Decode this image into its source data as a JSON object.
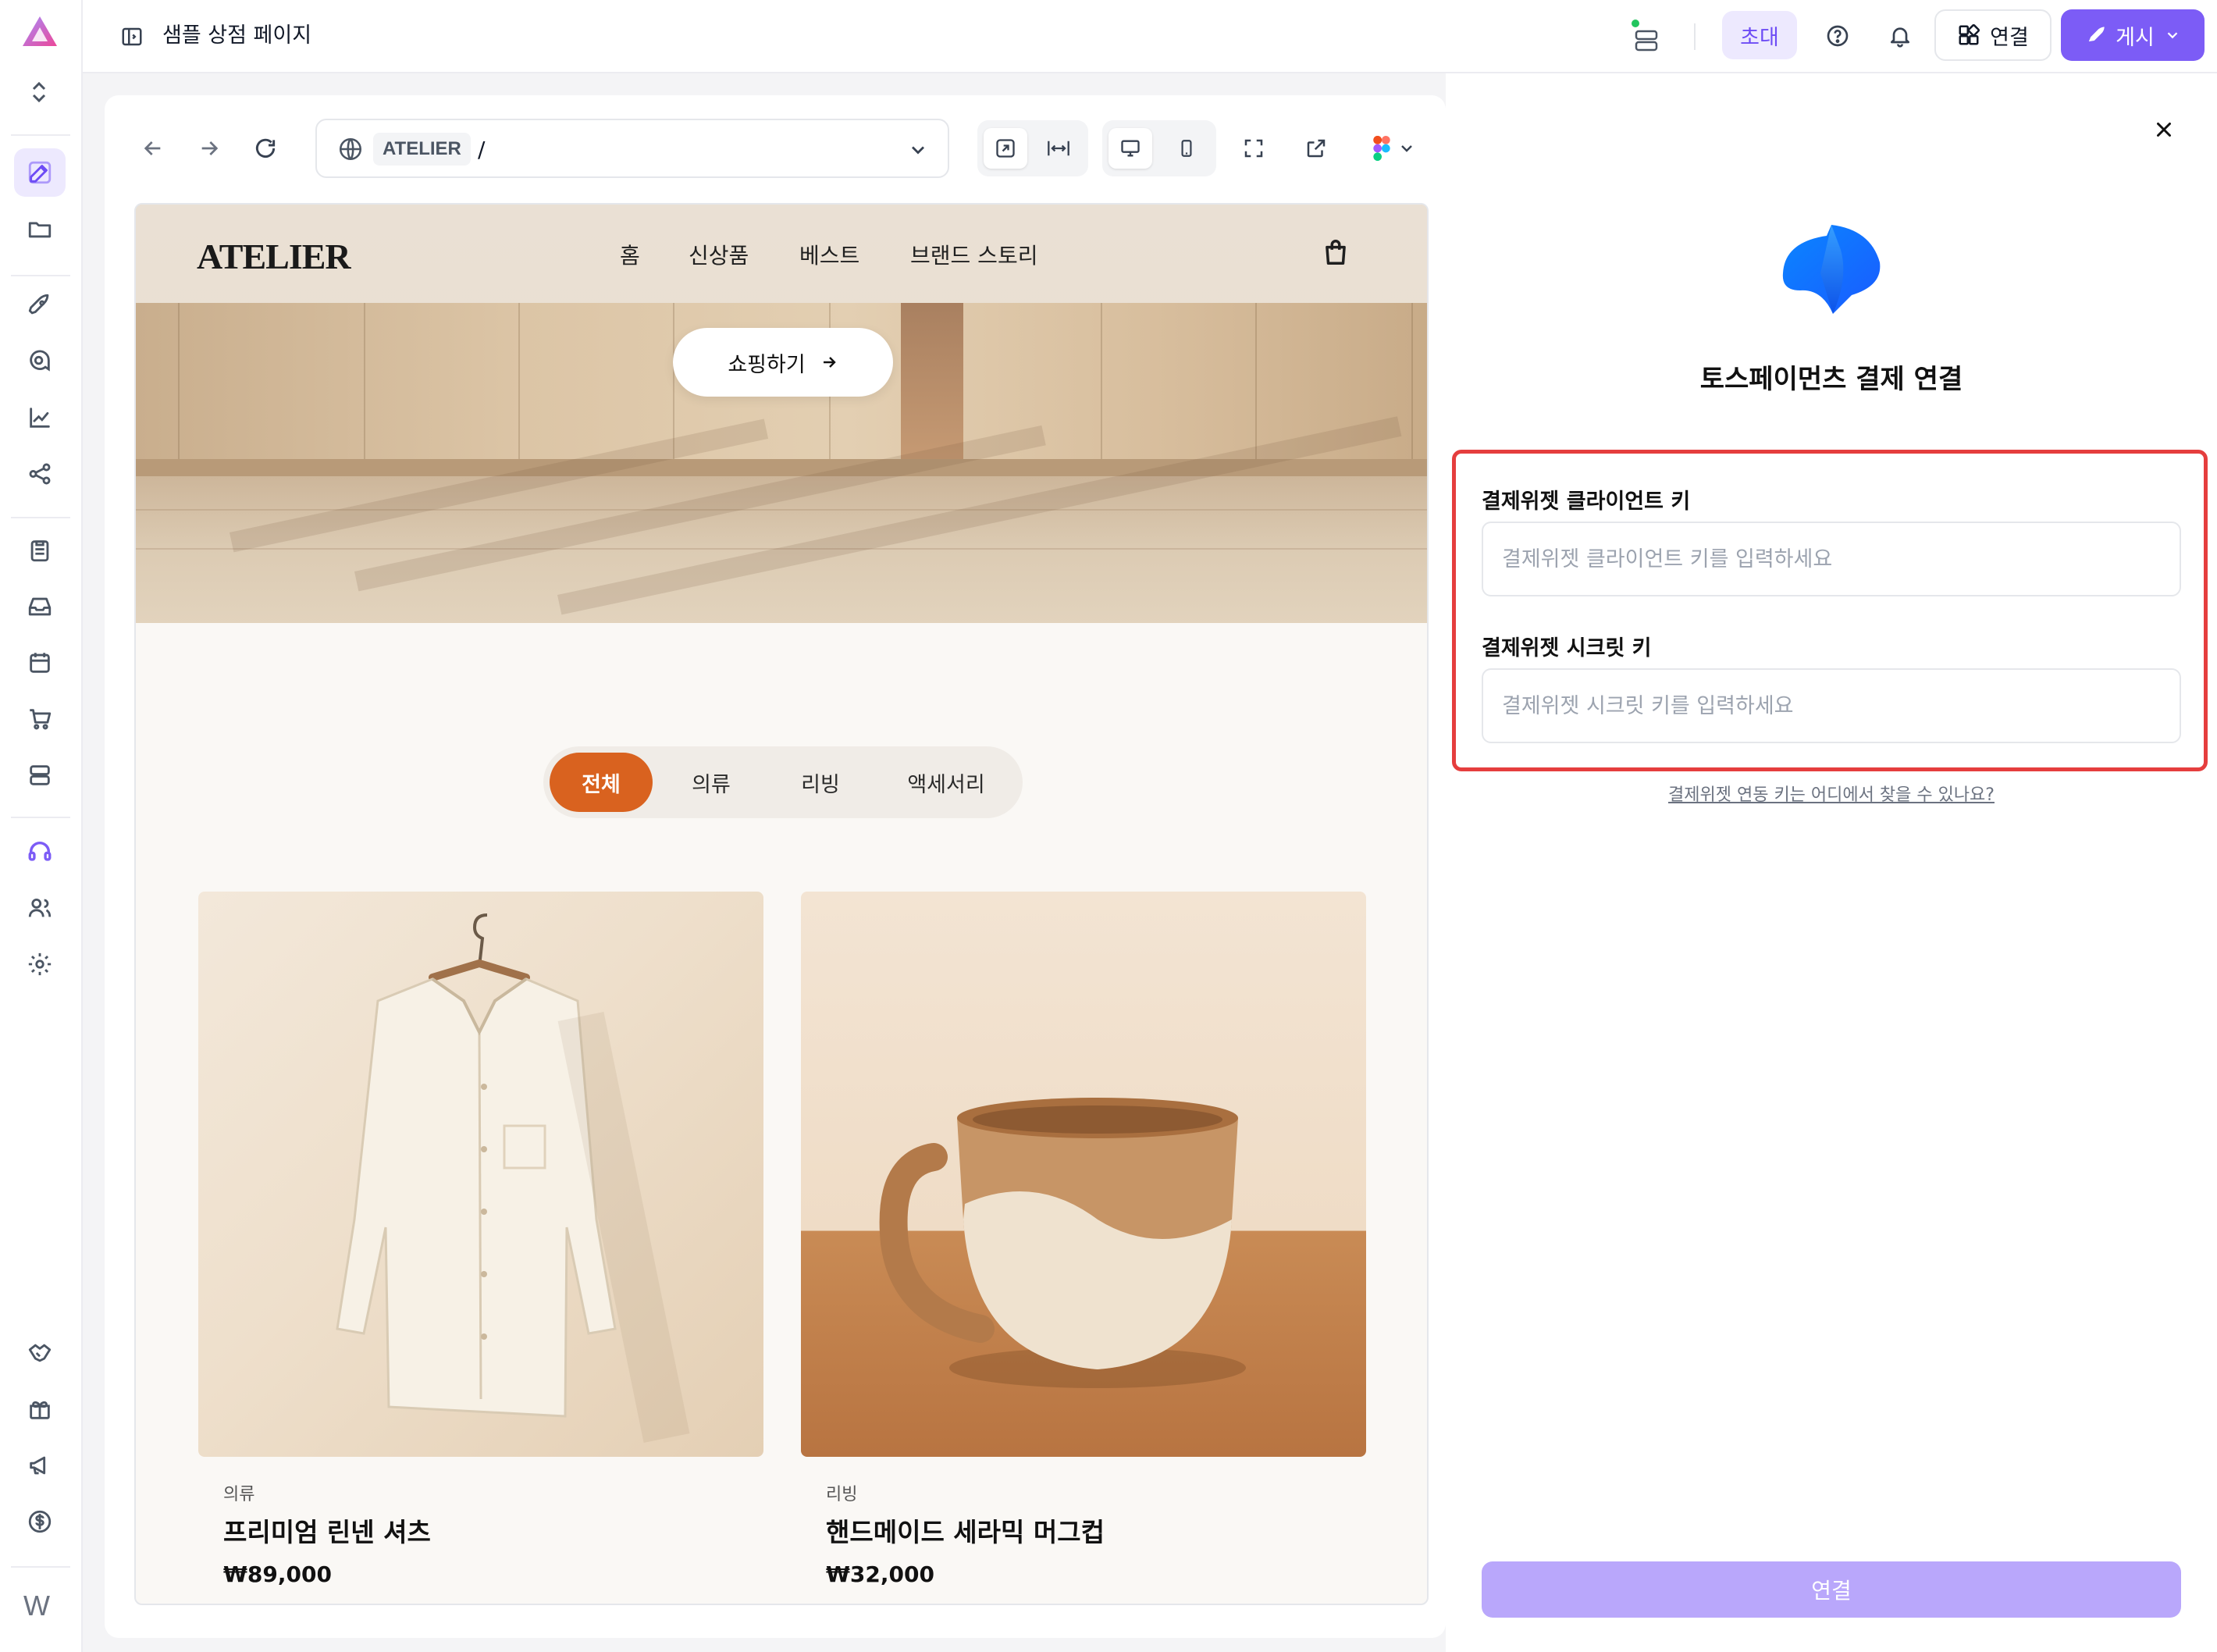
{
  "topbar": {
    "page_title": "샘플 상점 페이지",
    "invite_label": "초대",
    "connect_label": "연결",
    "publish_label": "게시"
  },
  "rail": {
    "bottom_label": "W"
  },
  "browser": {
    "site_name": "ATELIER",
    "path": "/"
  },
  "site": {
    "logo": "ATELIER",
    "nav": [
      "홈",
      "신상품",
      "베스트",
      "브랜드 스토리"
    ],
    "hero_button": "쇼핑하기",
    "categories": [
      "전체",
      "의류",
      "리빙",
      "액세서리"
    ],
    "active_category": "전체",
    "products": [
      {
        "category": "의류",
        "name": "프리미엄 린넨 셔츠",
        "price": "₩89,000"
      },
      {
        "category": "리빙",
        "name": "핸드메이드 세라믹 머그컵",
        "price": "₩32,000"
      }
    ]
  },
  "panel": {
    "title": "토스페이먼츠 결제 연결",
    "client_key_label": "결제위젯 클라이언트 키",
    "client_key_placeholder": "결제위젯 클라이언트 키를 입력하세요",
    "client_key_value": "",
    "secret_key_label": "결제위젯 시크릿 키",
    "secret_key_placeholder": "결제위젯 시크릿 키를 입력하세요",
    "secret_key_value": "",
    "help_link": "결제위젯 연동 키는 어디에서 찾을 수 있나요?",
    "submit_label": "연결",
    "highlight_color": "#e53e3e"
  },
  "colors": {
    "accent": "#7c5cf6",
    "category_active": "#d9621f",
    "submit_disabled": "#b9a7fb"
  }
}
